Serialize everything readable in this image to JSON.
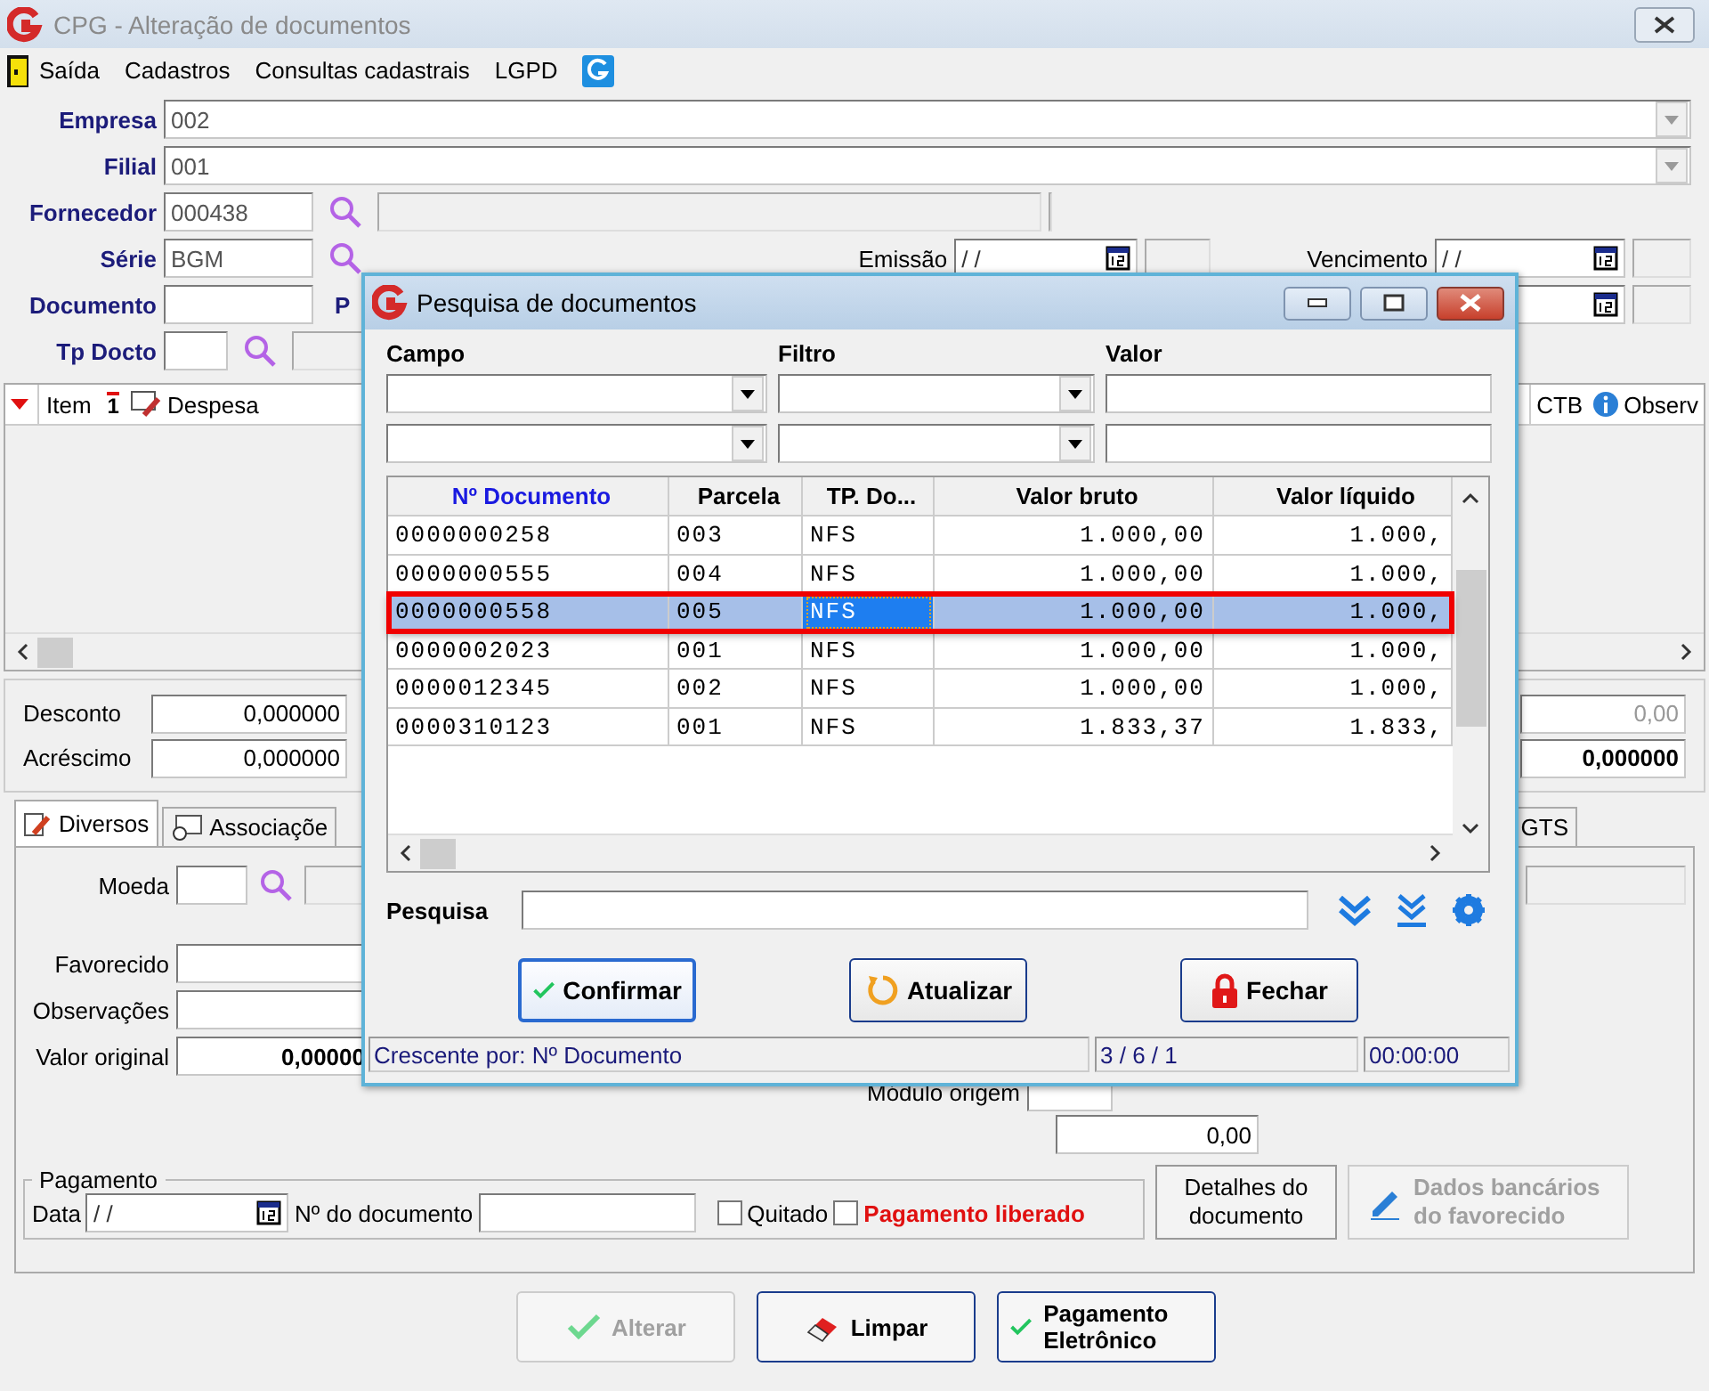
{
  "window": {
    "title": "CPG - Alteração de documentos"
  },
  "menu": [
    {
      "label": "Saída",
      "kind": "exit"
    },
    {
      "label": "Cadastros"
    },
    {
      "label": "Consultas cadastrais"
    },
    {
      "label": "LGPD"
    }
  ],
  "fields": {
    "empresa": {
      "label": "Empresa",
      "value": "002"
    },
    "filial": {
      "label": "Filial",
      "value": "001"
    },
    "fornecedor": {
      "label": "Fornecedor",
      "value": "000438"
    },
    "serie": {
      "label": "Série",
      "value": "BGM"
    },
    "emissao": {
      "label": "Emissão",
      "value": "/ /"
    },
    "vencimento": {
      "label": "Vencimento",
      "value": "/ /"
    },
    "documento": {
      "label": "Documento"
    },
    "documento_next_label": "P",
    "tp_docto": {
      "label": "Tp Docto"
    }
  },
  "items_grid": {
    "columns": [
      {
        "label": "Item",
        "sort_rank": "1"
      },
      {
        "label": "Despesa"
      },
      {
        "label": "CTB"
      },
      {
        "label": "Observ"
      }
    ]
  },
  "totals": {
    "desconto": {
      "label": "Desconto",
      "value": "0,000000"
    },
    "acrescimo": {
      "label": "Acréscimo",
      "value": "0,000000"
    },
    "right_values": [
      {
        "value": "0,00",
        "disabled": true
      },
      {
        "value": "0,000000",
        "disabled": false
      }
    ]
  },
  "tabs": [
    {
      "label": "Diversos",
      "selected": true,
      "kind": "edit"
    },
    {
      "label": "Associaçõe",
      "selected": false,
      "kind": "link"
    },
    {
      "label": "GTS",
      "selected": false
    }
  ],
  "panel": {
    "moeda": {
      "label": "Moeda"
    },
    "favorecido": {
      "label": "Favorecido"
    },
    "observacoes": {
      "label": "Observações"
    },
    "valor_original": {
      "label": "Valor original",
      "value": "0,00000"
    },
    "modulo_origem": {
      "label": "Módulo origem"
    },
    "amount": "0,00"
  },
  "pagamento": {
    "legend": "Pagamento",
    "data_label": "Data",
    "data_value": "/ /",
    "doc_label": "Nº do documento",
    "quitado": {
      "label": "Quitado",
      "checked": false
    },
    "liberado": {
      "label": "Pagamento liberado",
      "checked": false
    }
  },
  "side_buttons": [
    {
      "label": "Detalhes do documento",
      "disabled": false
    },
    {
      "label": "Dados bancários do favorecido",
      "disabled": true,
      "kind": "pencil"
    }
  ],
  "actions": [
    {
      "label": "Alterar",
      "disabled": true,
      "kind": "check"
    },
    {
      "label": "Limpar",
      "disabled": false,
      "kind": "eraser"
    },
    {
      "label": "Pagamento Eletrônico",
      "disabled": false,
      "kind": "check"
    }
  ],
  "dialog": {
    "title": "Pesquisa de documentos",
    "filter_labels": [
      "Campo",
      "Filtro",
      "Valor"
    ],
    "filter_rows": [
      {
        "kind": "criteria"
      },
      {
        "kind": "criteria"
      }
    ],
    "columns": [
      {
        "label": "Nº Documento",
        "sorted": true,
        "focused": false
      },
      {
        "label": "Parcela",
        "sorted": false,
        "focused": false
      },
      {
        "label": "TP. Do...",
        "sorted": false,
        "focused": true
      },
      {
        "label": "Valor bruto",
        "sorted": false,
        "focused": false
      },
      {
        "label": "Valor líquido",
        "sorted": false,
        "focused": false
      }
    ],
    "rows": [
      {
        "cells": [
          "0000000258",
          "003",
          "NFS",
          "1.000,00",
          "1.000,"
        ],
        "selected": false
      },
      {
        "cells": [
          "0000000555",
          "004",
          "NFS",
          "1.000,00",
          "1.000,"
        ],
        "selected": false
      },
      {
        "cells": [
          "0000000558",
          "005",
          "NFS",
          "1.000,00",
          "1.000,"
        ],
        "selected": true
      },
      {
        "cells": [
          "0000002023",
          "001",
          "NFS",
          "1.000,00",
          "1.000,"
        ],
        "selected": false
      },
      {
        "cells": [
          "0000012345",
          "002",
          "NFS",
          "1.000,00",
          "1.000,"
        ],
        "selected": false
      },
      {
        "cells": [
          "0000310123",
          "001",
          "NFS",
          "1.833,37",
          "1.833,"
        ],
        "selected": false
      }
    ],
    "search_label": "Pesquisa",
    "buttons": [
      {
        "label": "Confirmar",
        "kind": "check",
        "default": true
      },
      {
        "label": "Atualizar",
        "kind": "refresh",
        "default": false
      },
      {
        "label": "Fechar",
        "kind": "lock",
        "default": false
      }
    ],
    "status": [
      "Crescente por: Nº Documento",
      "3 / 6 / 1",
      "00:00:00"
    ]
  }
}
